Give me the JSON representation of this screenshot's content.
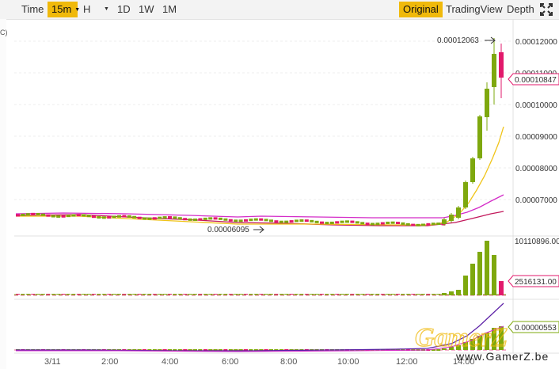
{
  "toolbar": {
    "intervals": [
      "Time",
      "15m",
      "H",
      "1D",
      "1W",
      "1M"
    ],
    "active_interval": "15m",
    "views": [
      "Original",
      "TradingView",
      "Depth"
    ],
    "active_view": "Original",
    "fullscreen_icon": "fullscreen-icon"
  },
  "left_axis_fragment": "C)",
  "price_axis": {
    "ticks": [
      "0.00012000",
      "0.00011000",
      "0.00010000",
      "0.00009000",
      "0.00008000",
      "0.00007000"
    ],
    "current_price": "0.00010847",
    "high_label": "0.00012063",
    "low_label": "0.00006095"
  },
  "volume_axis": {
    "max_label": "10110896.00",
    "current_label": "2516131.00"
  },
  "indicator_axis": {
    "current_label": "0.00000553"
  },
  "time_axis": [
    "3/11",
    "2:00",
    "4:00",
    "6:00",
    "8:00",
    "10:00",
    "12:00",
    "14:00"
  ],
  "colors": {
    "up": "#7ea80e",
    "down": "#e2196b",
    "accent": "#f0b90b",
    "ma_fast": "#f0c419",
    "ma_mid": "#d42cc8",
    "ma_slow": "#c2185b",
    "signal": "#5b1fa6"
  },
  "watermark": {
    "logo": "GamerZ",
    "url": "www.GamerZ.be"
  }
}
